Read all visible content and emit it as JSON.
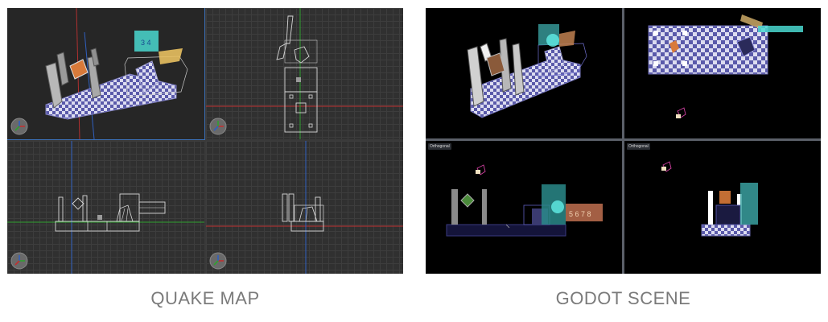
{
  "captions": {
    "left": "QUAKE MAP",
    "right": "GODOT SCENE"
  },
  "godot": {
    "ortho_label": "Orthogonal"
  },
  "textures": {
    "numbers_top": "3 4",
    "numbers_side": "5 6 7 8"
  },
  "colors": {
    "checker_blue": "#5a5aaa",
    "checker_white": "#dcdcf0",
    "axis_red": "#c03030",
    "axis_green": "#30a030",
    "axis_blue": "#3060c0",
    "selection_cyan": "#4ad8d0"
  }
}
